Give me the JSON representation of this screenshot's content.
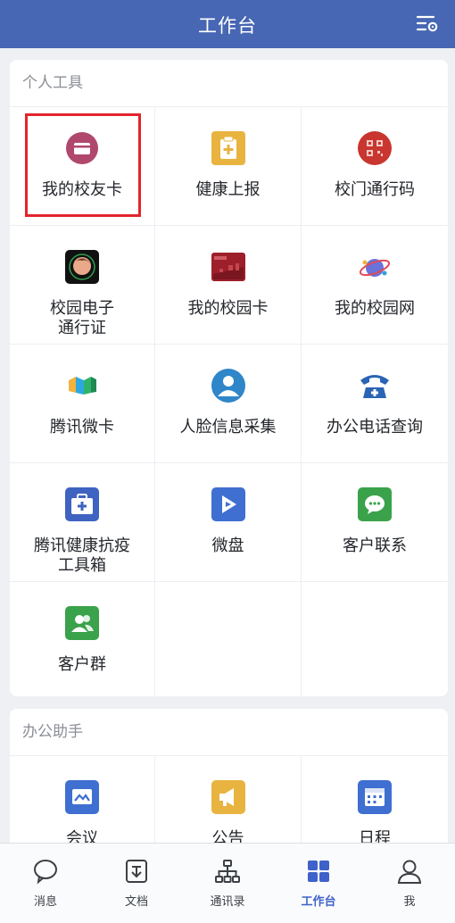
{
  "header": {
    "title": "工作台",
    "settings_icon": "list-settings-icon"
  },
  "sections": [
    {
      "title": "个人工具",
      "items": [
        {
          "label": "我的校友卡",
          "icon": "card-icon"
        },
        {
          "label": "健康上报",
          "icon": "clipboard-plus-icon"
        },
        {
          "label": "校门通行码",
          "icon": "qr-code-icon"
        },
        {
          "label": "校园电子\n通行证",
          "icon": "avatar-pass-icon"
        },
        {
          "label": "我的校园卡",
          "icon": "campus-card-icon"
        },
        {
          "label": "我的校园网",
          "icon": "network-globe-icon"
        },
        {
          "label": "腾讯微卡",
          "icon": "weika-logo-icon"
        },
        {
          "label": "人脸信息采集",
          "icon": "face-person-icon"
        },
        {
          "label": "办公电话查询",
          "icon": "phone-search-icon"
        },
        {
          "label": "腾讯健康抗疫\n工具箱",
          "icon": "medical-kit-icon"
        },
        {
          "label": "微盘",
          "icon": "drive-icon"
        },
        {
          "label": "客户联系",
          "icon": "chat-bubble-icon"
        },
        {
          "label": "客户群",
          "icon": "group-people-icon"
        }
      ]
    },
    {
      "title": "办公助手",
      "items": [
        {
          "label": "会议",
          "icon": "meeting-icon"
        },
        {
          "label": "公告",
          "icon": "megaphone-icon"
        },
        {
          "label": "日程",
          "icon": "calendar-icon"
        }
      ]
    }
  ],
  "tabbar": [
    {
      "label": "消息",
      "icon": "chat-icon",
      "active": false
    },
    {
      "label": "文档",
      "icon": "document-icon",
      "active": false
    },
    {
      "label": "通讯录",
      "icon": "org-chart-icon",
      "active": false
    },
    {
      "label": "工作台",
      "icon": "grid-icon",
      "active": true
    },
    {
      "label": "我",
      "icon": "person-icon",
      "active": false
    }
  ],
  "colors": {
    "header": "#4766b3",
    "accent": "#3e62c9",
    "highlight": "#e3242b"
  }
}
